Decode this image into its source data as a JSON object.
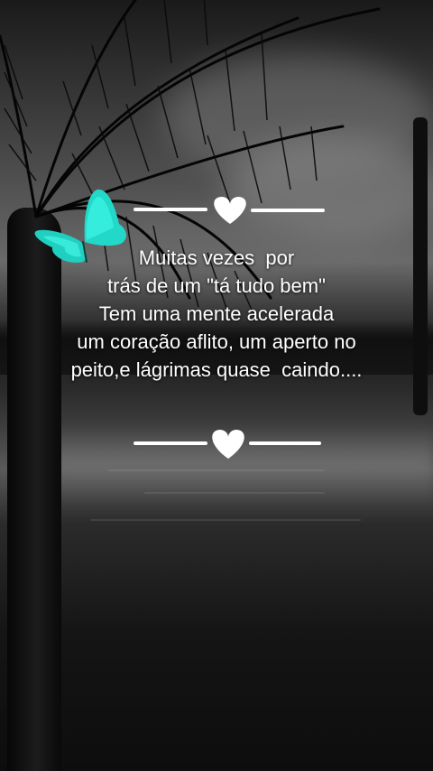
{
  "quote": {
    "lines": [
      "Muitas vezes  por",
      "trás de um \"tá tudo bem\"",
      "Tem uma mente acelerada",
      "um coração aflito, um aperto no",
      "peito,e lágrimas quase  caindo...."
    ]
  },
  "decorations": {
    "top_divider_icon": "heart-icon",
    "bottom_divider_icon": "heart-icon",
    "butterfly_icon": "butterfly-icon",
    "butterfly_color": "#2ee6d6"
  }
}
